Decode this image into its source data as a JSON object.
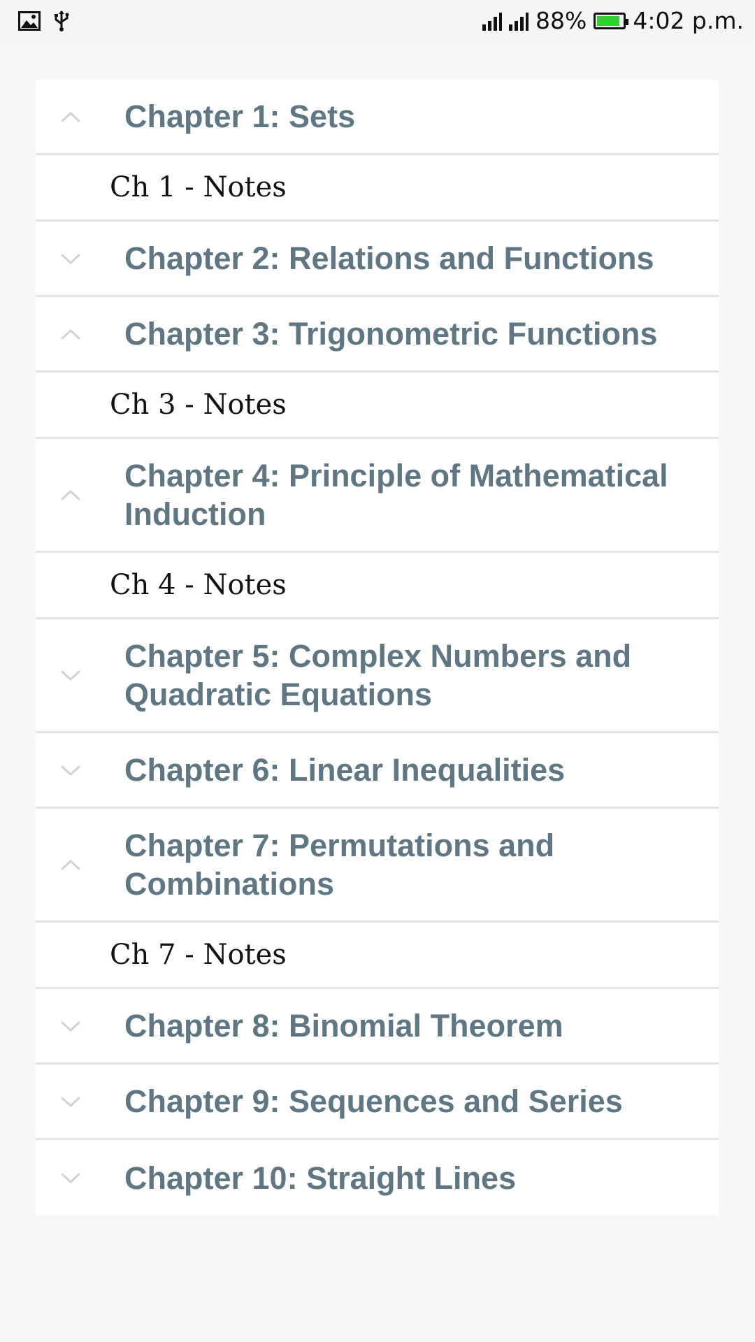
{
  "status_bar": {
    "battery_percent": "88%",
    "time": "4:02 p.m.",
    "battery_level": 0.88,
    "battery_color": "#2fd12f",
    "icons": [
      "image-icon",
      "usb-icon",
      "signal-icon",
      "signal-icon",
      "battery-icon"
    ]
  },
  "chapters": [
    {
      "title": "Chapter 1: Sets",
      "expanded": true,
      "notes": "Ch 1 - Notes"
    },
    {
      "title": "Chapter 2: Relations and Functions",
      "expanded": false
    },
    {
      "title": "Chapter 3: Trigonometric Functions",
      "expanded": true,
      "notes": "Ch 3 - Notes"
    },
    {
      "title": "Chapter 4: Principle of Mathematical Induction",
      "expanded": true,
      "notes": "Ch 4 - Notes"
    },
    {
      "title": "Chapter 5: Complex Numbers and Quadratic Equations",
      "expanded": false
    },
    {
      "title": "Chapter 6: Linear Inequalities",
      "expanded": false
    },
    {
      "title": "Chapter 7: Permutations and Combinations",
      "expanded": true,
      "notes": "Ch 7 - Notes"
    },
    {
      "title": "Chapter 8: Binomial Theorem",
      "expanded": false
    },
    {
      "title": "Chapter 9: Sequences and Series",
      "expanded": false
    },
    {
      "title": "Chapter 10: Straight Lines",
      "expanded": false
    }
  ],
  "colors": {
    "chapter_title": "#5f7683",
    "chevron": "#cfd3d6"
  }
}
